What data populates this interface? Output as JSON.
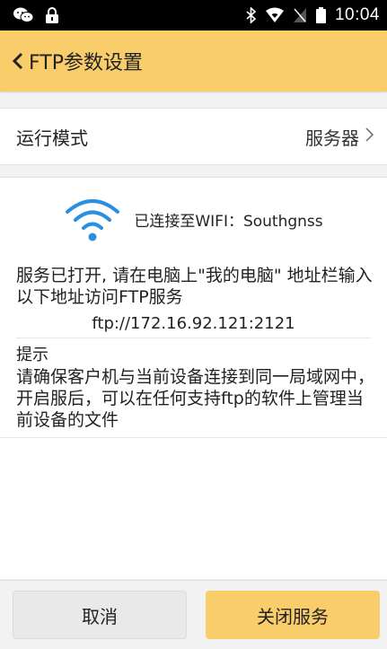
{
  "status_bar": {
    "time": "10:04",
    "left_icons": [
      "wechat-icon",
      "lock-icon"
    ],
    "right_icons": [
      "bluetooth-icon",
      "wifi-signal-icon",
      "no-sim-icon",
      "battery-icon"
    ]
  },
  "app_bar": {
    "title": "FTP参数设置",
    "back_icon": "chevron-left-icon",
    "color": "#f8cd6a"
  },
  "mode_row": {
    "label": "运行模式",
    "value": "服务器"
  },
  "connection": {
    "wifi_text": "已连接至WIFI：Southgnss",
    "icon_color": "#2a8fe0"
  },
  "message": {
    "instruction": "服务已打开, 请在电脑上\"我的电脑\" 地址栏输入以下地址访问FTP服务",
    "address": "ftp://172.16.92.121:2121"
  },
  "tip": {
    "title": "提示",
    "text": "请确保客户机与当前设备连接到同一局域网中，开启服后，可以在任何支持ftp的软件上管理当前设备的文件"
  },
  "buttons": {
    "cancel": "取消",
    "stop_service": "关闭服务"
  }
}
